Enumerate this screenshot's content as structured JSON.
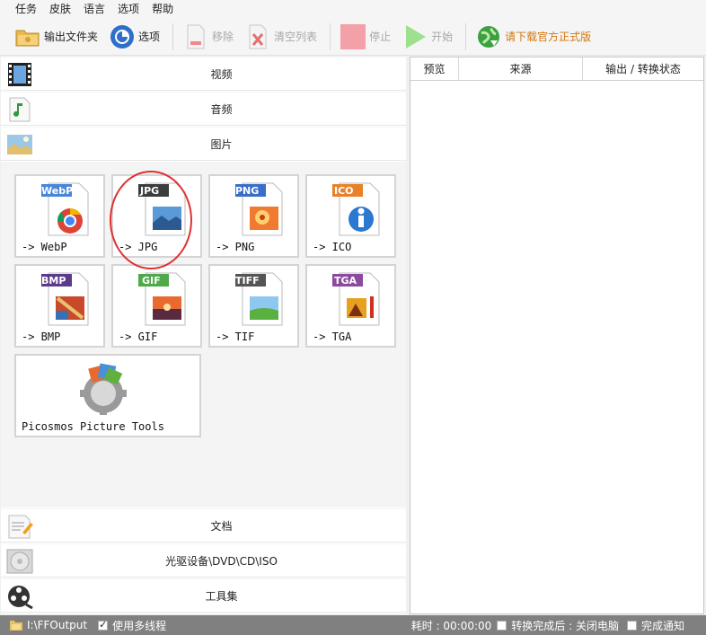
{
  "menu": [
    "任务",
    "皮肤",
    "语言",
    "选项",
    "帮助"
  ],
  "toolbar": {
    "output_folder": "输出文件夹",
    "options": "选项",
    "remove": "移除",
    "clear_list": "清空列表",
    "stop": "停止",
    "start": "开始",
    "download": "请下载官方正式版"
  },
  "categories": {
    "video": "视频",
    "audio": "音频",
    "picture": "图片",
    "document": "文档",
    "optical": "光驱设备\\DVD\\CD\\ISO",
    "tools": "工具集"
  },
  "tiles": [
    {
      "badge": "WebP",
      "label": "-> WebP",
      "color": "#4a86d8",
      "icon": "chrome-icon"
    },
    {
      "badge": "JPG",
      "label": "-> JPG",
      "color": "#3c3c3c",
      "icon": "landscape-image-icon"
    },
    {
      "badge": "PNG",
      "label": "-> PNG",
      "color": "#3a6fc8",
      "icon": "flower-image-icon"
    },
    {
      "badge": "ICO",
      "label": "-> ICO",
      "color": "#e8822a",
      "icon": "info-icon"
    },
    {
      "badge": "BMP",
      "label": "-> BMP",
      "color": "#5b3a8c",
      "icon": "painting-icon"
    },
    {
      "badge": "GIF",
      "label": "-> GIF",
      "color": "#4fa84a",
      "icon": "sunset-image-icon"
    },
    {
      "badge": "TIFF",
      "label": "-> TIF",
      "color": "#555555",
      "icon": "field-image-icon"
    },
    {
      "badge": "TGA",
      "label": "-> TGA",
      "color": "#8a4aa0",
      "icon": "autumn-image-icon"
    }
  ],
  "tools_tile": {
    "label": "Picosmos Picture Tools",
    "icon": "picosmos-gear-icon"
  },
  "table_headers": [
    "预览",
    "来源",
    "输出 / 转换状态"
  ],
  "status": {
    "path": "I:\\FFOutput",
    "multithread": "使用多线程",
    "elapsed": "耗时 : 00:00:00",
    "after": "转换完成后 : 关闭电脑",
    "notify": "完成通知"
  }
}
